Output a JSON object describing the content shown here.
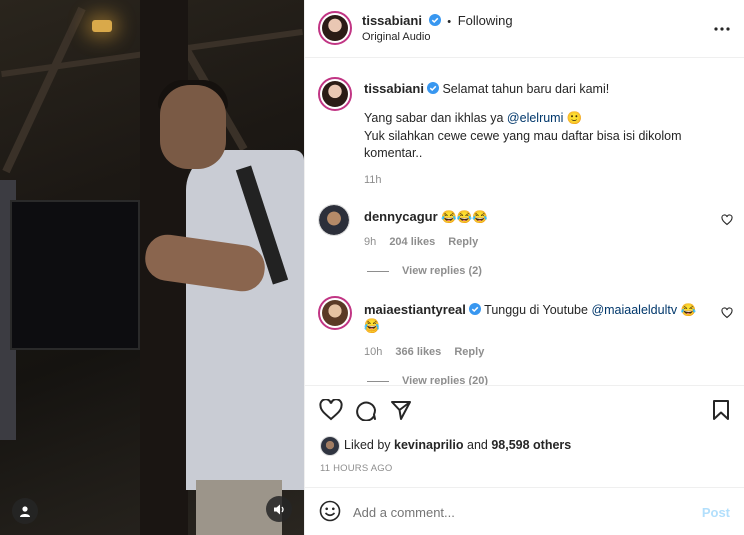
{
  "post": {
    "author": "tissabiani",
    "separator": "•",
    "follow_status": "Following",
    "audio": "Original Audio"
  },
  "caption": {
    "author": "tissabiani",
    "line1": "Selamat tahun baru dari kami!",
    "line2_prefix": "Yang sabar dan ikhlas ya ",
    "mention": "@elelrumi",
    "emoji": "🙂",
    "line3": "Yuk silahkan cewe cewe yang mau daftar bisa isi dikolom komentar..",
    "time": "11h"
  },
  "comments": [
    {
      "username": "dennycagur",
      "text": "😂😂😂",
      "time": "9h",
      "likes": "204 likes",
      "reply": "Reply",
      "view_replies": "View replies (2)"
    },
    {
      "username": "maiaestiantyreal",
      "text_prefix": "Tunggu di Youtube ",
      "mention": "@maiaaleldultv",
      "text_suffix": " 😂😂",
      "text_line2": "😂",
      "time": "10h",
      "likes": "366 likes",
      "reply": "Reply",
      "view_replies": "View replies (20)"
    }
  ],
  "likes": {
    "prefix": "Liked by ",
    "user": "kevinaprilio",
    "middle": " and ",
    "count": "98,598 others"
  },
  "timestamp": "11 HOURS AGO",
  "add_comment": {
    "placeholder": "Add a comment...",
    "post_label": "Post"
  },
  "icons": {
    "like": "heart-icon",
    "comment": "comment-icon",
    "share": "share-icon",
    "save": "bookmark-icon",
    "more": "more-icon",
    "emoji": "emoji-icon",
    "user_tag": "user-tag-icon",
    "audio": "speaker-icon"
  },
  "colors": {
    "verified": "#3897f0",
    "link": "#00376b",
    "muted": "#8e8e8e",
    "post_disabled": "#b2dffc",
    "heart_comment": "#262626"
  }
}
